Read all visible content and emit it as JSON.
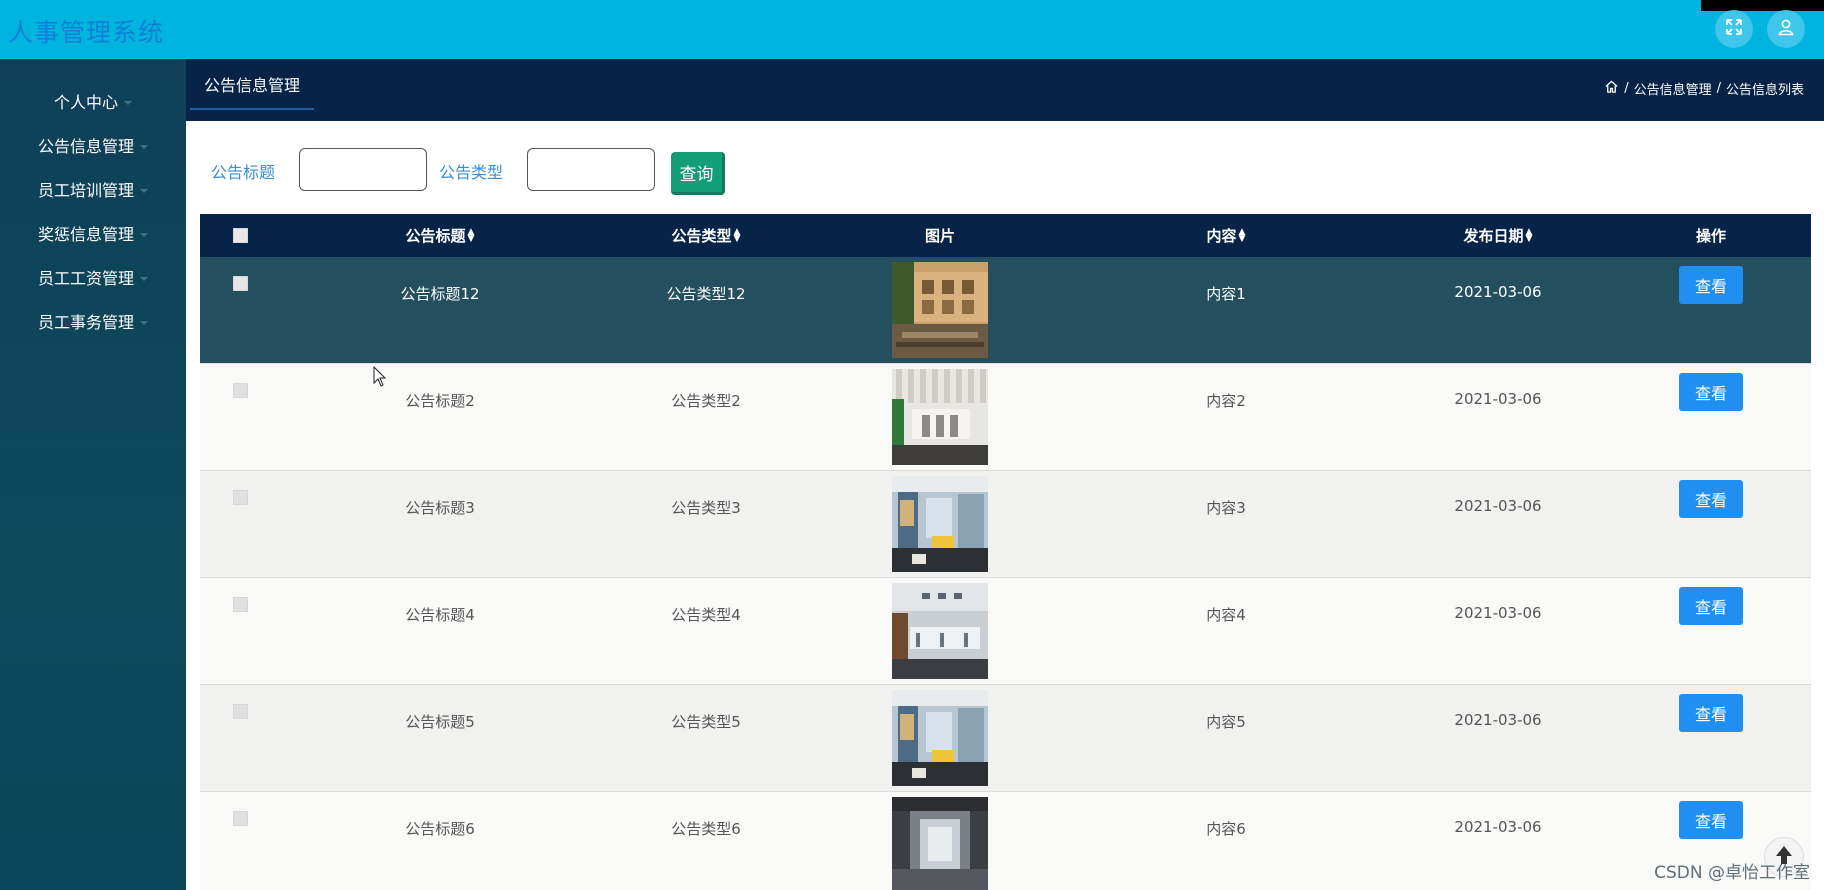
{
  "header": {
    "app_title": "人事管理系统"
  },
  "sidebar": {
    "items": [
      {
        "label": "个人中心"
      },
      {
        "label": "公告信息管理"
      },
      {
        "label": "员工培训管理"
      },
      {
        "label": "奖惩信息管理"
      },
      {
        "label": "员工工资管理"
      },
      {
        "label": "员工事务管理"
      }
    ]
  },
  "page": {
    "tab_label": "公告信息管理",
    "breadcrumb": [
      "公告信息管理",
      "公告信息列表"
    ]
  },
  "search": {
    "title_label": "公告标题",
    "title_value": "",
    "type_label": "公告类型",
    "type_value": "",
    "query_label": "查询"
  },
  "table": {
    "headers": {
      "title": "公告标题",
      "type": "公告类型",
      "image": "图片",
      "content": "内容",
      "date": "发布日期",
      "action": "操作"
    },
    "rows": [
      {
        "title": "公告标题12",
        "type": "公告类型12",
        "content": "内容1",
        "date": "2021-03-06",
        "action": "查看"
      },
      {
        "title": "公告标题2",
        "type": "公告类型2",
        "content": "内容2",
        "date": "2021-03-06",
        "action": "查看"
      },
      {
        "title": "公告标题3",
        "type": "公告类型3",
        "content": "内容3",
        "date": "2021-03-06",
        "action": "查看"
      },
      {
        "title": "公告标题4",
        "type": "公告类型4",
        "content": "内容4",
        "date": "2021-03-06",
        "action": "查看"
      },
      {
        "title": "公告标题5",
        "type": "公告类型5",
        "content": "内容5",
        "date": "2021-03-06",
        "action": "查看"
      },
      {
        "title": "公告标题6",
        "type": "公告类型6",
        "content": "内容6",
        "date": "2021-03-06",
        "action": "查看"
      }
    ]
  },
  "watermark": "CSDN @卓怡工作室",
  "colors": {
    "header_bg": "#00b4e0",
    "app_title": "#0f7fd8",
    "sidebar_bg": "#0f3f59",
    "content_head_bg": "#072347",
    "query_button": "#149e78",
    "view_button": "#1f8ff2",
    "active_row": "#244f5f"
  },
  "icons": {
    "fullscreen": "fullscreen-icon",
    "user": "user-icon",
    "home": "home-icon",
    "back_to_top": "arrow-up-icon",
    "sort": "sort-icon"
  }
}
